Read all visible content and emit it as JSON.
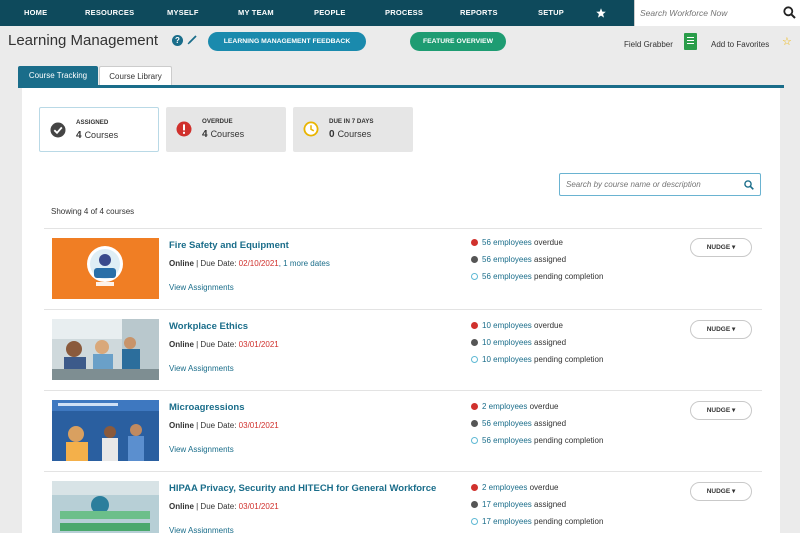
{
  "nav": {
    "items": [
      "HOME",
      "RESOURCES",
      "MYSELF",
      "MY TEAM",
      "PEOPLE",
      "PROCESS",
      "REPORTS",
      "SETUP"
    ],
    "search_placeholder": "Search Workforce Now"
  },
  "header": {
    "title": "Learning Management",
    "feedback_label": "LEARNING MANAGEMENT FEEDBACK",
    "feature_label": "FEATURE OVERVIEW",
    "field_grabber": "Field Grabber",
    "add_favorites": "Add to Favorites"
  },
  "tabs": [
    "Course Tracking",
    "Course Library"
  ],
  "summary": [
    {
      "title": "ASSIGNED",
      "count": "4",
      "unit": "Courses"
    },
    {
      "title": "OVERDUE",
      "count": "4",
      "unit": "Courses"
    },
    {
      "title": "DUE IN 7 DAYS",
      "count": "0",
      "unit": "Courses"
    }
  ],
  "course_search_placeholder": "Search by course name or description",
  "showing": "Showing 4 of 4 courses",
  "common": {
    "sep": "| Due Date: ",
    "view": "View Assignments",
    "nudge": "NUDGE",
    "overdue": "overdue",
    "assigned": "assigned",
    "pending": "pending completion"
  },
  "courses": [
    {
      "title": "Fire Safety and Equipment",
      "mode": "Online",
      "due": "02/10/2021",
      "more": ", 1 more dates",
      "overdue": "56 employees",
      "assigned": "56 employees",
      "pending": "56 employees"
    },
    {
      "title": "Workplace Ethics",
      "mode": "Online",
      "due": "03/01/2021",
      "more": "",
      "overdue": "10 employees",
      "assigned": "10 employees",
      "pending": "10 employees"
    },
    {
      "title": "Microagressions",
      "mode": "Online",
      "due": "03/01/2021",
      "more": "",
      "overdue": "2 employees",
      "assigned": "56 employees",
      "pending": "56 employees"
    },
    {
      "title": "HIPAA Privacy, Security and HITECH for General Workforce",
      "mode": "Online",
      "due": "03/01/2021",
      "more": "",
      "overdue": "2 employees",
      "assigned": "17 employees",
      "pending": "17 employees"
    }
  ],
  "colors": {
    "nav": "#0e4a5c",
    "accent": "#1a6d8a",
    "overdue": "#d0312d",
    "feature": "#1e9c72"
  }
}
